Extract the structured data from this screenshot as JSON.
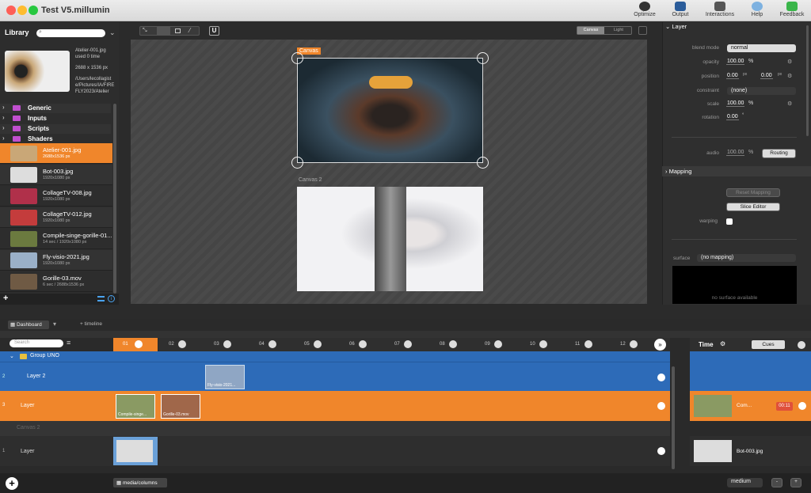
{
  "window": {
    "title": "Test V5.millumin"
  },
  "toolbar": {
    "items": [
      {
        "label": "Optimize"
      },
      {
        "label": "Output"
      },
      {
        "label": "Interactions"
      },
      {
        "label": "Help"
      },
      {
        "label": "Feedback"
      }
    ]
  },
  "library": {
    "title": "Library",
    "preview": {
      "name": "Atelier-001.jpg",
      "used": "used 0 time",
      "size": "2688 x 1536 px",
      "path": "/Users/lecollagiste/Pictures/IA/FIREFLY2023/Atelier"
    },
    "folders": [
      "Generic",
      "Inputs",
      "Scripts",
      "Shaders"
    ],
    "items": [
      {
        "name": "Atelier-001.jpg",
        "info": "2688x1536 px"
      },
      {
        "name": "Bot-003.jpg",
        "info": "1920x1080 px"
      },
      {
        "name": "CollageTV-008.jpg",
        "info": "1920x1080 px"
      },
      {
        "name": "CollageTV-012.jpg",
        "info": "1920x1080 px"
      },
      {
        "name": "Compile-singe-gorille-01...",
        "info": "14 sec / 1920x1080 px"
      },
      {
        "name": "Fly-visio-2021.jpg",
        "info": "1920x1080 px"
      },
      {
        "name": "Gorille-03.mov",
        "info": "6 sec / 2688x1536 px"
      }
    ]
  },
  "viewer": {
    "modes": [
      "Canvas",
      "Light"
    ],
    "canvas1": "Canvas",
    "canvas2": "Canvas 2",
    "snap": "U"
  },
  "inspector": {
    "layer_title": "Layer",
    "blend_label": "blend mode",
    "blend": "normal",
    "opacity_label": "opacity",
    "opacity": "100.00",
    "pct": "%",
    "position_label": "position",
    "pos_x": "0.00",
    "pos_y": "0.00",
    "px": "px",
    "constraint_label": "constraint",
    "constraint": "(none)",
    "scale_label": "scale",
    "scale": "100.00",
    "rotation_label": "rotation",
    "rotation": "0.00",
    "deg": "°",
    "audio_label": "audio",
    "audio": "100.00",
    "routing": "Routing",
    "mapping_title": "Mapping",
    "reset_mapping": "Reset Mapping",
    "slice_editor": "Slice Editor",
    "warping_label": "warping",
    "surface_label": "surface",
    "surface": "(no mapping)",
    "no_surface": "no surface available"
  },
  "dashboard": {
    "tab": "Dashboard",
    "timeline": "+ timeline",
    "search": "Search",
    "columns": [
      "01",
      "02",
      "03",
      "04",
      "05",
      "06",
      "07",
      "08",
      "09",
      "10",
      "11",
      "12"
    ],
    "layers": [
      {
        "num": "",
        "name": "Group UNO"
      },
      {
        "num": "2",
        "name": "Layer 2"
      },
      {
        "num": "3",
        "name": "Layer"
      },
      {
        "num": "",
        "name": "Canvas 2"
      },
      {
        "num": "1",
        "name": "Layer"
      }
    ],
    "clips": {
      "l2": "Fly-visio-2021...",
      "l3a": "Compile-singe...",
      "l3b": "Gorille-03.mov",
      "c2": "Bot-003.jpg"
    },
    "time": "Time",
    "cues": "Cues",
    "now_playing": "Com...",
    "timer": "00:11",
    "bot": "Bot-003.jpg",
    "bottom_btn": "media/columns",
    "zoom": "medium",
    "minus": "-",
    "plus": "+"
  },
  "colors": {
    "accent": "#f0862b",
    "blue": "#2d6bb8"
  }
}
